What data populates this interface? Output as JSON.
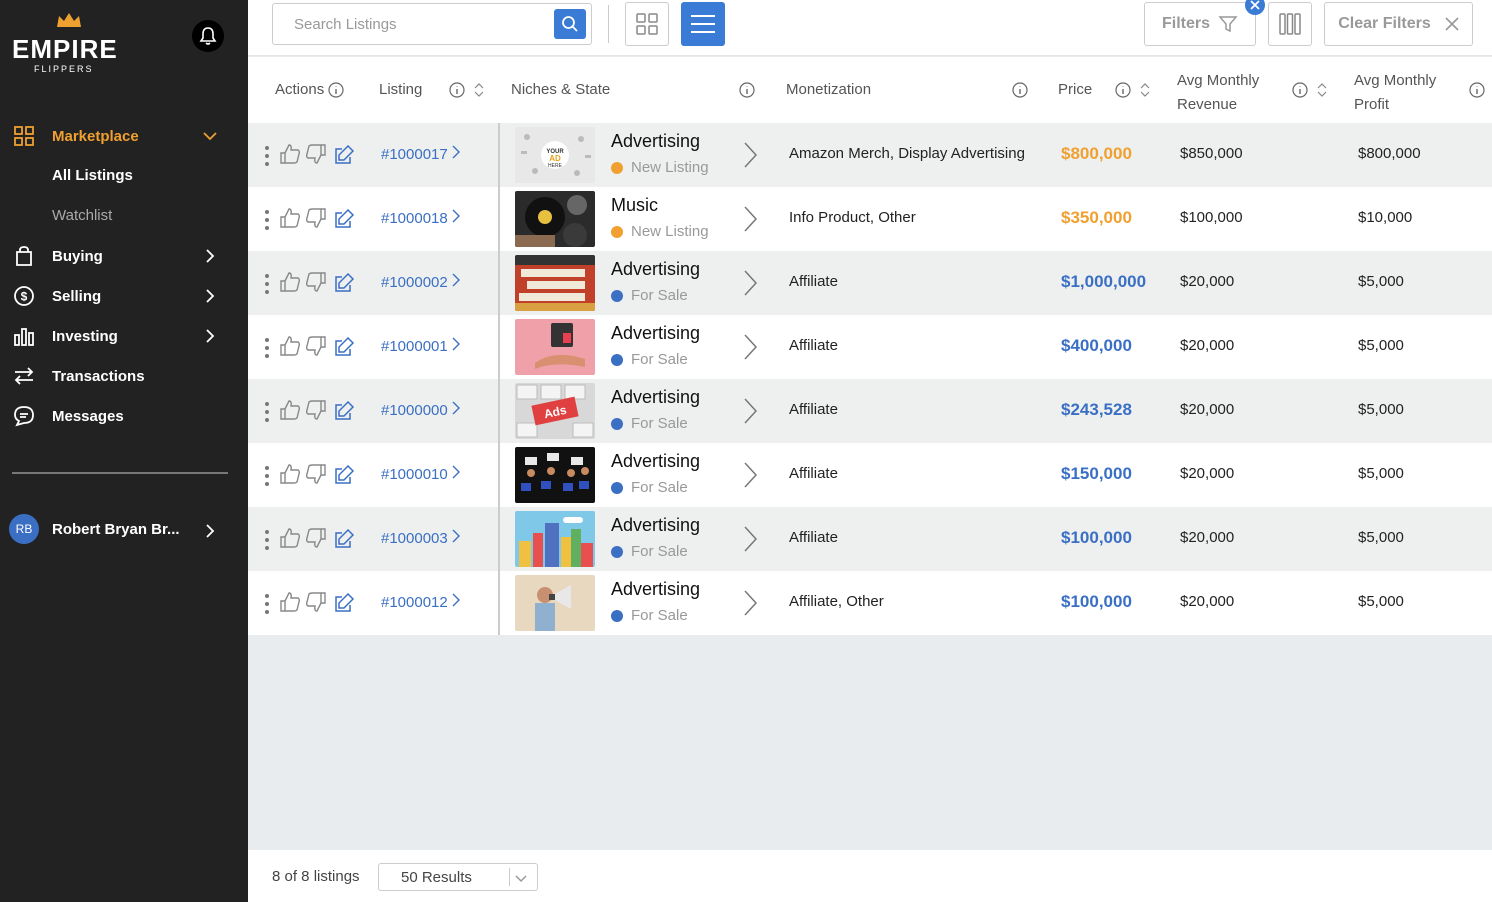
{
  "app": {
    "logo_text": "EMPIRE",
    "logo_sub": "FLIPPERS",
    "brand_color": "#f0a030",
    "accent_color": "#3a7bd5"
  },
  "sidebar": {
    "items": [
      {
        "label": "Marketplace",
        "icon": "grid-icon",
        "active": true
      },
      {
        "label": "Buying",
        "icon": "shopping-bag-icon"
      },
      {
        "label": "Selling",
        "icon": "dollar-circle-icon"
      },
      {
        "label": "Investing",
        "icon": "bar-chart-icon"
      },
      {
        "label": "Transactions",
        "icon": "arrows-exchange-icon"
      },
      {
        "label": "Messages",
        "icon": "chat-icon"
      }
    ],
    "sub_items": [
      {
        "label": "All Listings",
        "selected": true
      },
      {
        "label": "Watchlist",
        "selected": false
      }
    ],
    "user": {
      "initials": "RB",
      "name": "Robert Bryan Br..."
    }
  },
  "toolbar": {
    "search_placeholder": "Search Listings",
    "filters_label": "Filters",
    "clear_filters_label": "Clear Filters"
  },
  "table": {
    "headers": {
      "actions": "Actions",
      "listing": "Listing",
      "niches": "Niches & State",
      "monetization": "Monetization",
      "price": "Price",
      "revenue_1": "Avg Monthly",
      "revenue_2": "Revenue",
      "profit_1": "Avg Monthly",
      "profit_2": "Profit"
    },
    "rows": [
      {
        "id": "#1000017",
        "niche": "Advertising",
        "state": "New Listing",
        "state_color": "#f0a030",
        "monetization": "Amazon Merch, Display Advertising",
        "price": "$800,000",
        "price_color": "#f0a030",
        "revenue": "$850,000",
        "profit": "$800,000"
      },
      {
        "id": "#1000018",
        "niche": "Music",
        "state": "New Listing",
        "state_color": "#f0a030",
        "monetization": "Info Product, Other",
        "price": "$350,000",
        "price_color": "#f0a030",
        "revenue": "$100,000",
        "profit": "$10,000"
      },
      {
        "id": "#1000002",
        "niche": "Advertising",
        "state": "For Sale",
        "state_color": "#3a6fc4",
        "monetization": "Affiliate",
        "price": "$1,000,000",
        "price_color": "#3a6fc4",
        "revenue": "$20,000",
        "profit": "$5,000"
      },
      {
        "id": "#1000001",
        "niche": "Advertising",
        "state": "For Sale",
        "state_color": "#3a6fc4",
        "monetization": "Affiliate",
        "price": "$400,000",
        "price_color": "#3a6fc4",
        "revenue": "$20,000",
        "profit": "$5,000"
      },
      {
        "id": "#1000000",
        "niche": "Advertising",
        "state": "For Sale",
        "state_color": "#3a6fc4",
        "monetization": "Affiliate",
        "price": "$243,528",
        "price_color": "#3a6fc4",
        "revenue": "$20,000",
        "profit": "$5,000"
      },
      {
        "id": "#1000010",
        "niche": "Advertising",
        "state": "For Sale",
        "state_color": "#3a6fc4",
        "monetization": "Affiliate",
        "price": "$150,000",
        "price_color": "#3a6fc4",
        "revenue": "$20,000",
        "profit": "$5,000"
      },
      {
        "id": "#1000003",
        "niche": "Advertising",
        "state": "For Sale",
        "state_color": "#3a6fc4",
        "monetization": "Affiliate",
        "price": "$100,000",
        "price_color": "#3a6fc4",
        "revenue": "$20,000",
        "profit": "$5,000"
      },
      {
        "id": "#1000012",
        "niche": "Advertising",
        "state": "For Sale",
        "state_color": "#3a6fc4",
        "monetization": "Affiliate, Other",
        "price": "$100,000",
        "price_color": "#3a6fc4",
        "revenue": "$20,000",
        "profit": "$5,000"
      }
    ]
  },
  "footer": {
    "count_text": "8 of 8 listings",
    "per_page": "50 Results"
  }
}
